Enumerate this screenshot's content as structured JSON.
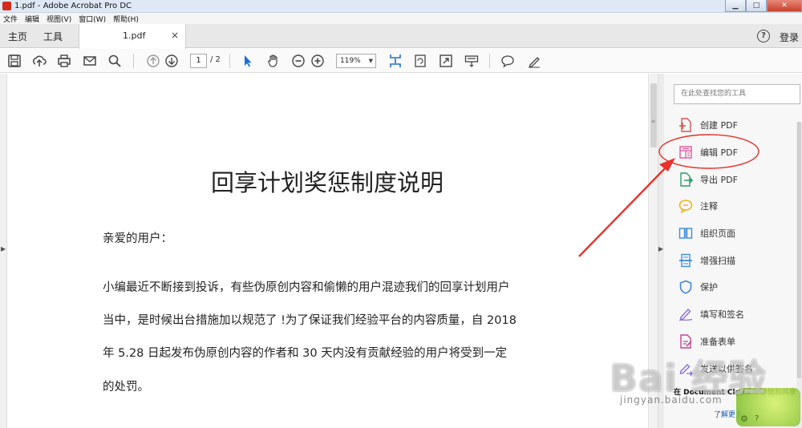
{
  "window": {
    "title": "1.pdf - Adobe Acrobat Pro DC",
    "minimize": "0",
    "maximize": "1",
    "close": "r"
  },
  "menu": [
    "文件",
    "编辑",
    "视图(V)",
    "窗口(W)",
    "帮助(H)"
  ],
  "tabs": {
    "home": "主页",
    "tools": "工具",
    "doc": "1.pdf",
    "close": "×",
    "help": "?",
    "login": "登录"
  },
  "toolbar": {
    "page_current": "1",
    "page_total": "/ 2",
    "zoom": "119%"
  },
  "document": {
    "title": "回享计划奖惩制度说明",
    "greeting": "亲爱的用户：",
    "lines": [
      "小编最近不断接到投诉，有些伪原创内容和偷懒的用户混迹我们的回享计划用户",
      "当中，是时候出台措施加以规范了 !为了保证我们经验平台的内容质量，自 2018",
      "年 5.28 日起发布伪原创内容的作者和 30 天内没有贡献经验的用户将受到一定",
      "的处罚。"
    ]
  },
  "tools_pane": {
    "search_placeholder": "在此处查找您的工具",
    "items": [
      {
        "label": "创建 PDF",
        "icon": "create-pdf-icon",
        "color": "#d9534f"
      },
      {
        "label": "编辑 PDF",
        "icon": "edit-pdf-icon",
        "color": "#e0569a"
      },
      {
        "label": "导出 PDF",
        "icon": "export-pdf-icon",
        "color": "#2e9e6a"
      },
      {
        "label": "注释",
        "icon": "comment-icon",
        "color": "#f0b323"
      },
      {
        "label": "组织页面",
        "icon": "organize-pages-icon",
        "color": "#3b8ed8"
      },
      {
        "label": "增强扫描",
        "icon": "enhance-scan-icon",
        "color": "#3b8ed8"
      },
      {
        "label": "保护",
        "icon": "protect-icon",
        "color": "#3b7fd8"
      },
      {
        "label": "填写和签名",
        "icon": "fill-sign-icon",
        "color": "#8b6ad8"
      },
      {
        "label": "准备表单",
        "icon": "prepare-form-icon",
        "color": "#c2448f"
      },
      {
        "label": "发送以供签名",
        "icon": "send-sign-icon",
        "color": "#8b6ad8"
      }
    ],
    "cloud_text": "在 Document Cloud 中存储和共享",
    "learn_more": "了解更多"
  },
  "watermark": {
    "main": "Bai 经验",
    "sub": "jingyan.baidu.com"
  },
  "colors": {
    "accent_blue": "#1f6fd1",
    "annotation_red": "#e8312b"
  }
}
